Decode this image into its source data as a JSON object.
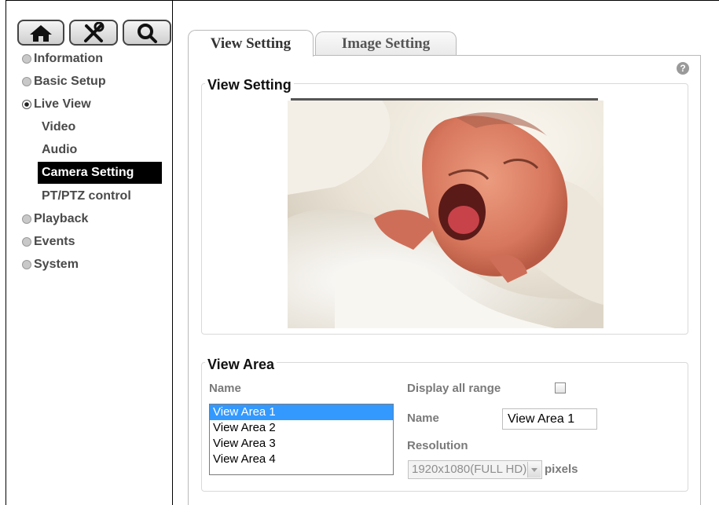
{
  "sidebar": {
    "top_icons": [
      {
        "icon": "home-icon"
      },
      {
        "icon": "tools-icon"
      },
      {
        "icon": "search-icon"
      }
    ],
    "items": [
      {
        "label": "Information",
        "state": "collapsed"
      },
      {
        "label": "Basic Setup",
        "state": "collapsed"
      },
      {
        "label": "Live View",
        "state": "expanded"
      },
      {
        "label": "Playback",
        "state": "collapsed"
      },
      {
        "label": "Events",
        "state": "collapsed"
      },
      {
        "label": "System",
        "state": "collapsed"
      }
    ],
    "live_view_subitems": [
      {
        "label": "Video"
      },
      {
        "label": "Audio"
      },
      {
        "label": "Camera Setting",
        "active": true
      },
      {
        "label": "PT/PTZ control"
      }
    ]
  },
  "tabs": [
    {
      "label": "View Setting",
      "active": true
    },
    {
      "label": "Image Setting",
      "active": false
    }
  ],
  "help": {
    "label": "?",
    "icon": "help-icon"
  },
  "view_setting": {
    "legend": "View Setting",
    "preview": {
      "subject": "crying newborn baby photo"
    }
  },
  "view_area": {
    "legend": "View Area",
    "name_column_label": "Name",
    "list": [
      "View Area 1",
      "View Area 2",
      "View Area 3",
      "View Area 4"
    ],
    "selected_index": 0,
    "display_all_range_label": "Display all range",
    "display_all_range_checked": false,
    "name_label": "Name",
    "name_value": "View Area 1",
    "resolution_label": "Resolution",
    "resolution_value": "1920x1080(FULL HD)",
    "resolution_unit": "pixels"
  },
  "colors": {
    "active_nav_bg": "#000000",
    "list_selection": "#3399ff",
    "border": "#b9b9b9"
  }
}
